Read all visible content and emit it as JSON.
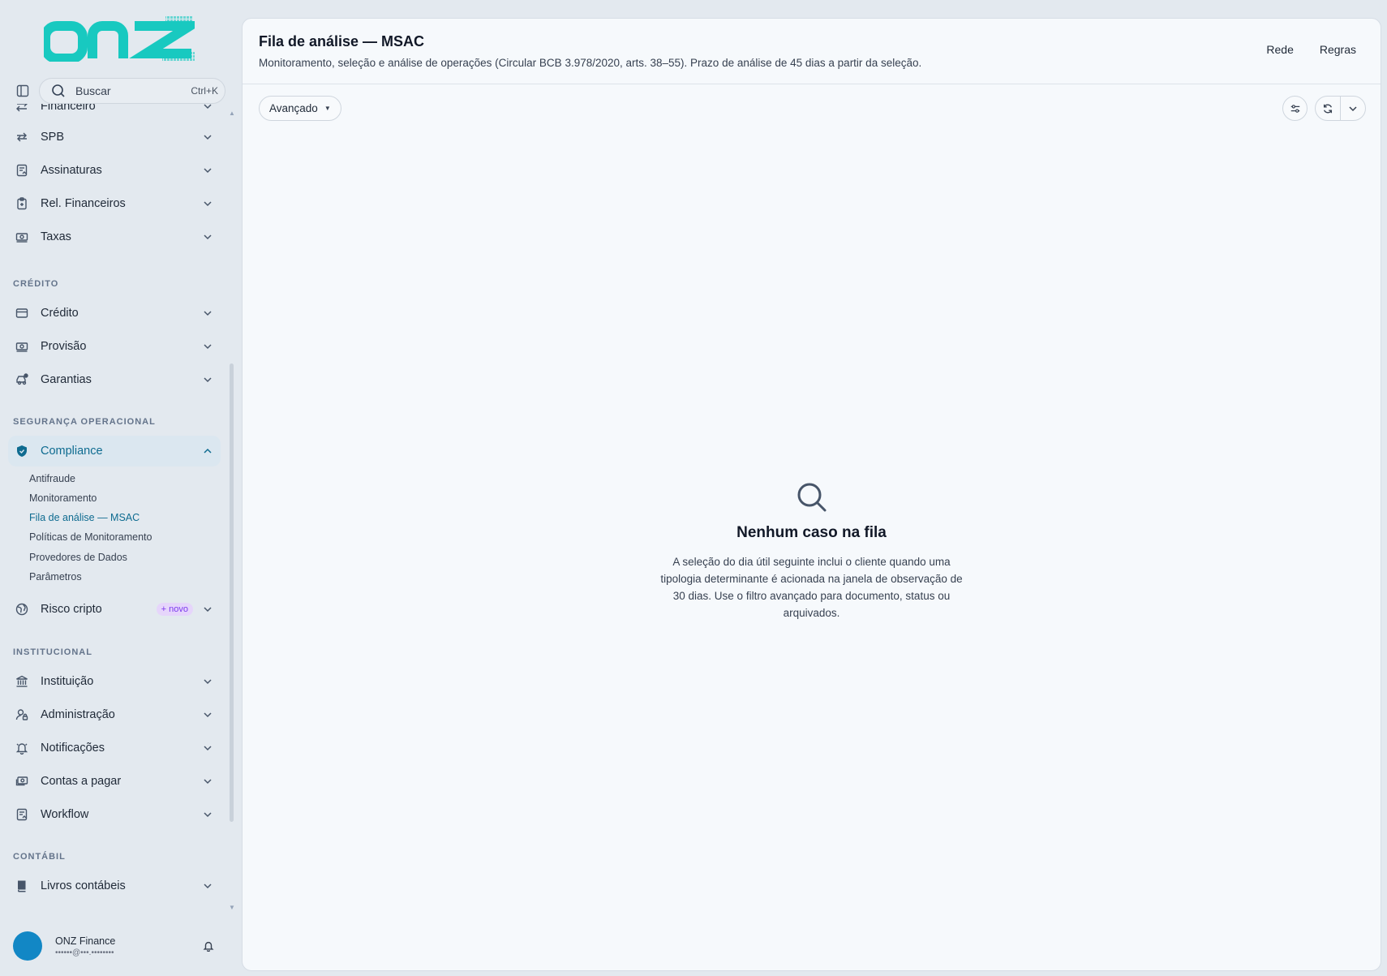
{
  "brand": {
    "logo_text": "onz",
    "accent": "#18c9c0"
  },
  "search": {
    "placeholder": "Buscar",
    "shortcut": "Ctrl+K"
  },
  "sidebar": {
    "partial_top_label": "Financeiro",
    "top_items": [
      {
        "label": "SPB",
        "icon": "arrows-exchange-icon"
      },
      {
        "label": "Assinaturas",
        "icon": "document-sign-icon"
      },
      {
        "label": "Rel. Financeiros",
        "icon": "clipboard-icon"
      },
      {
        "label": "Taxas",
        "icon": "money-icon"
      }
    ],
    "sections": [
      {
        "title": "CRÉDITO",
        "items": [
          {
            "label": "Crédito",
            "icon": "credit-card-icon"
          },
          {
            "label": "Provisão",
            "icon": "money-icon"
          },
          {
            "label": "Garantias",
            "icon": "car-icon"
          }
        ]
      },
      {
        "title": "SEGURANÇA OPERACIONAL",
        "items": [
          {
            "label": "Compliance",
            "icon": "shield-icon",
            "active": true,
            "children": [
              "Antifraude",
              "Monitoramento",
              "Fila de análise — MSAC",
              "Políticas de Monitoramento",
              "Provedores de Dados",
              "Parâmetros"
            ]
          },
          {
            "label": "Risco cripto",
            "icon": "globe-icon",
            "badge": "+ novo"
          }
        ]
      },
      {
        "title": "INSTITUCIONAL",
        "items": [
          {
            "label": "Instituição",
            "icon": "bank-icon"
          },
          {
            "label": "Administração",
            "icon": "user-lock-icon"
          },
          {
            "label": "Notificações",
            "icon": "bell-icon"
          },
          {
            "label": "Contas a pagar",
            "icon": "cash-icon"
          },
          {
            "label": "Workflow",
            "icon": "document-flow-icon"
          }
        ]
      },
      {
        "title": "CONTÁBIL",
        "items": [
          {
            "label": "Livros contábeis",
            "icon": "book-icon"
          }
        ]
      }
    ]
  },
  "user": {
    "name": "ONZ Finance",
    "email": "••••••@•••.••••••••",
    "avatar_color": "#1287c5"
  },
  "header": {
    "title": "Fila de análise — MSAC",
    "subtitle": "Monitoramento, seleção e análise de operações (Circular BCB 3.978/2020, arts. 38–55). Prazo de análise de 45 dias a partir da seleção.",
    "links": [
      "Rede",
      "Regras"
    ]
  },
  "toolbar": {
    "advanced_label": "Avançado"
  },
  "empty_state": {
    "title": "Nenhum caso na fila",
    "text": "A seleção do dia útil seguinte inclui o cliente quando uma tipologia determinante é acionada na janela de observação de 30 dias. Use o filtro avançado para documento, status ou arquivados."
  }
}
